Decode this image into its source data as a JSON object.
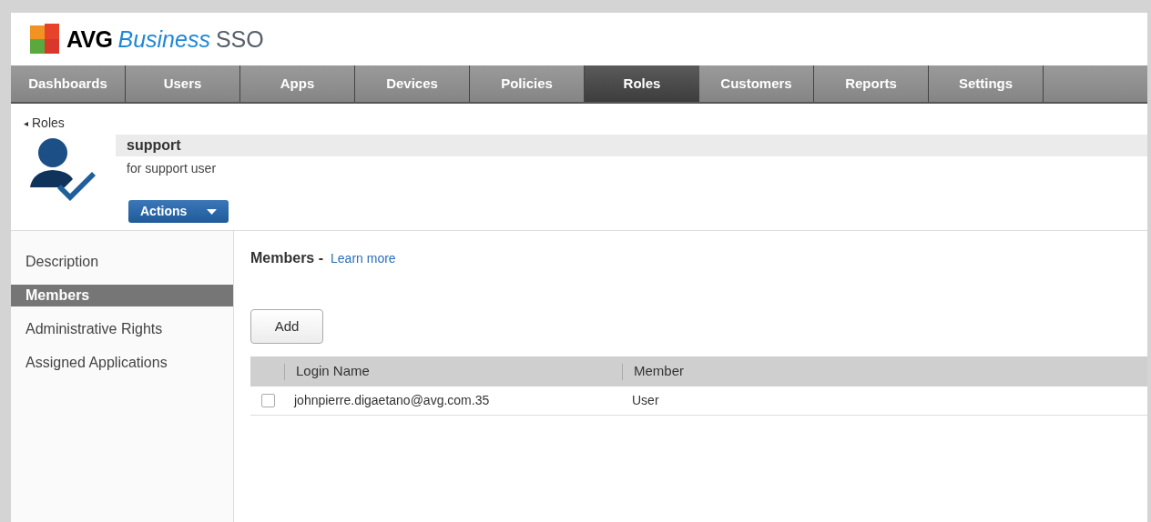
{
  "logo": {
    "brand": "AVG",
    "product": "Business",
    "suffix": "SSO"
  },
  "nav_tabs": [
    {
      "label": "Dashboards",
      "selected": false
    },
    {
      "label": "Users",
      "selected": false
    },
    {
      "label": "Apps",
      "selected": false
    },
    {
      "label": "Devices",
      "selected": false
    },
    {
      "label": "Policies",
      "selected": false
    },
    {
      "label": "Roles",
      "selected": true
    },
    {
      "label": "Customers",
      "selected": false
    },
    {
      "label": "Reports",
      "selected": false
    },
    {
      "label": "Settings",
      "selected": false
    }
  ],
  "breadcrumb": {
    "arrow": "◂",
    "label": "Roles"
  },
  "role": {
    "name": "support",
    "description": "for support user",
    "actions_button": "Actions"
  },
  "sidebar": {
    "items": [
      {
        "label": "Description",
        "selected": false
      },
      {
        "label": "Members",
        "selected": true
      },
      {
        "label": "Administrative Rights",
        "selected": false
      },
      {
        "label": "Assigned Applications",
        "selected": false
      }
    ]
  },
  "members": {
    "title": "Members -",
    "learn_more": "Learn more",
    "add_button": "Add",
    "table": {
      "columns": [
        "Login Name",
        "Member"
      ],
      "rows": [
        {
          "checked": false,
          "login_name": "johnpierre.digaetano@avg.com.35",
          "member": "User"
        }
      ]
    }
  }
}
